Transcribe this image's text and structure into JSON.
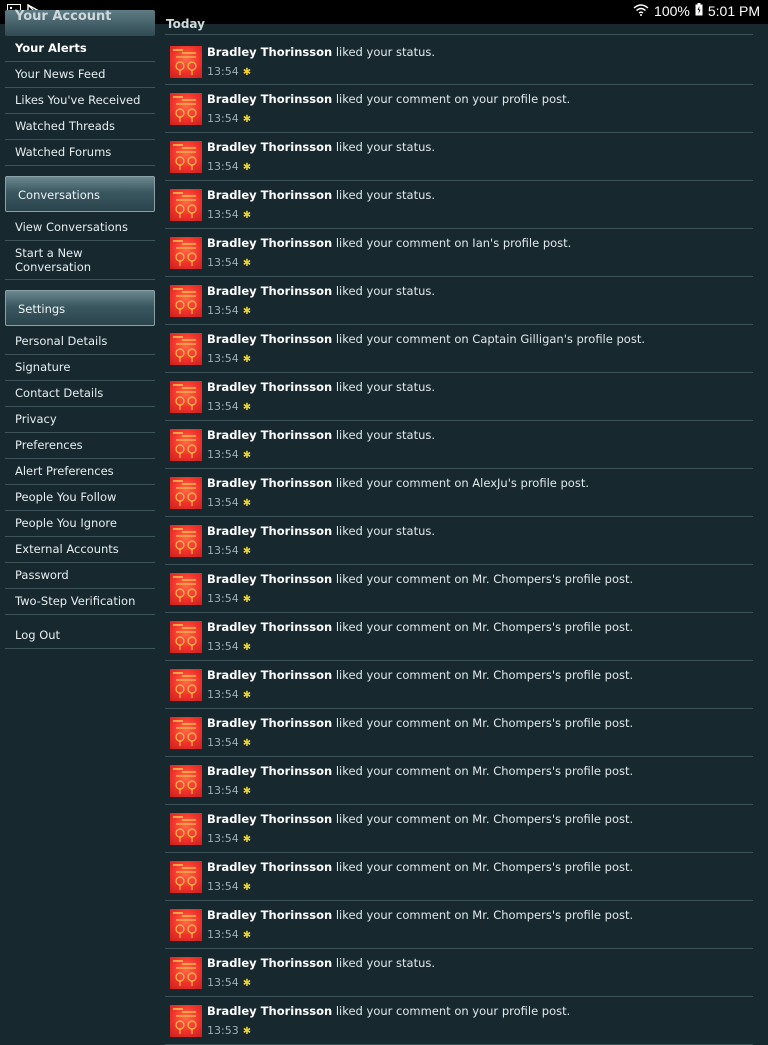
{
  "status_bar": {
    "battery": "100%",
    "time": "5:01 PM"
  },
  "sidebar": {
    "section_title": "Your Account",
    "account_items": [
      {
        "label": "Your Alerts"
      },
      {
        "label": "Your News Feed"
      },
      {
        "label": "Likes You've Received"
      },
      {
        "label": "Watched Threads"
      },
      {
        "label": "Watched Forums"
      }
    ],
    "conversations_title": "Conversations",
    "conversation_items": [
      {
        "label": "View Conversations"
      },
      {
        "label": "Start a New Conversation"
      }
    ],
    "settings_title": "Settings",
    "settings_items": [
      {
        "label": "Personal Details"
      },
      {
        "label": "Signature"
      },
      {
        "label": "Contact Details"
      },
      {
        "label": "Privacy"
      },
      {
        "label": "Preferences"
      },
      {
        "label": "Alert Preferences"
      },
      {
        "label": "People You Follow"
      },
      {
        "label": "People You Ignore"
      },
      {
        "label": "External Accounts"
      },
      {
        "label": "Password"
      },
      {
        "label": "Two-Step Verification"
      }
    ],
    "logout_label": "Log Out"
  },
  "main": {
    "section_header": "Today",
    "alerts": [
      {
        "user": "Bradley Thorinsson",
        "text": "liked your status.",
        "time": "13:54"
      },
      {
        "user": "Bradley Thorinsson",
        "text": "liked your comment on your profile post.",
        "time": "13:54"
      },
      {
        "user": "Bradley Thorinsson",
        "text": "liked your status.",
        "time": "13:54"
      },
      {
        "user": "Bradley Thorinsson",
        "text": "liked your status.",
        "time": "13:54"
      },
      {
        "user": "Bradley Thorinsson",
        "text": "liked your comment on Ian's profile post.",
        "time": "13:54"
      },
      {
        "user": "Bradley Thorinsson",
        "text": "liked your status.",
        "time": "13:54"
      },
      {
        "user": "Bradley Thorinsson",
        "text": "liked your comment on Captain Gilligan's profile post.",
        "time": "13:54"
      },
      {
        "user": "Bradley Thorinsson",
        "text": "liked your status.",
        "time": "13:54"
      },
      {
        "user": "Bradley Thorinsson",
        "text": "liked your status.",
        "time": "13:54"
      },
      {
        "user": "Bradley Thorinsson",
        "text": "liked your comment on AlexJu's profile post.",
        "time": "13:54"
      },
      {
        "user": "Bradley Thorinsson",
        "text": "liked your status.",
        "time": "13:54"
      },
      {
        "user": "Bradley Thorinsson",
        "text": "liked your comment on Mr. Chompers's profile post.",
        "time": "13:54"
      },
      {
        "user": "Bradley Thorinsson",
        "text": "liked your comment on Mr. Chompers's profile post.",
        "time": "13:54"
      },
      {
        "user": "Bradley Thorinsson",
        "text": "liked your comment on Mr. Chompers's profile post.",
        "time": "13:54"
      },
      {
        "user": "Bradley Thorinsson",
        "text": "liked your comment on Mr. Chompers's profile post.",
        "time": "13:54"
      },
      {
        "user": "Bradley Thorinsson",
        "text": "liked your comment on Mr. Chompers's profile post.",
        "time": "13:54"
      },
      {
        "user": "Bradley Thorinsson",
        "text": "liked your comment on Mr. Chompers's profile post.",
        "time": "13:54"
      },
      {
        "user": "Bradley Thorinsson",
        "text": "liked your comment on Mr. Chompers's profile post.",
        "time": "13:54"
      },
      {
        "user": "Bradley Thorinsson",
        "text": "liked your comment on Mr. Chompers's profile post.",
        "time": "13:54"
      },
      {
        "user": "Bradley Thorinsson",
        "text": "liked your status.",
        "time": "13:54"
      },
      {
        "user": "Bradley Thorinsson",
        "text": "liked your comment on your profile post.",
        "time": "13:53"
      }
    ]
  },
  "colors": {
    "background": "#17282f",
    "star": "#f2d32a",
    "avatar": "#f0322a"
  }
}
